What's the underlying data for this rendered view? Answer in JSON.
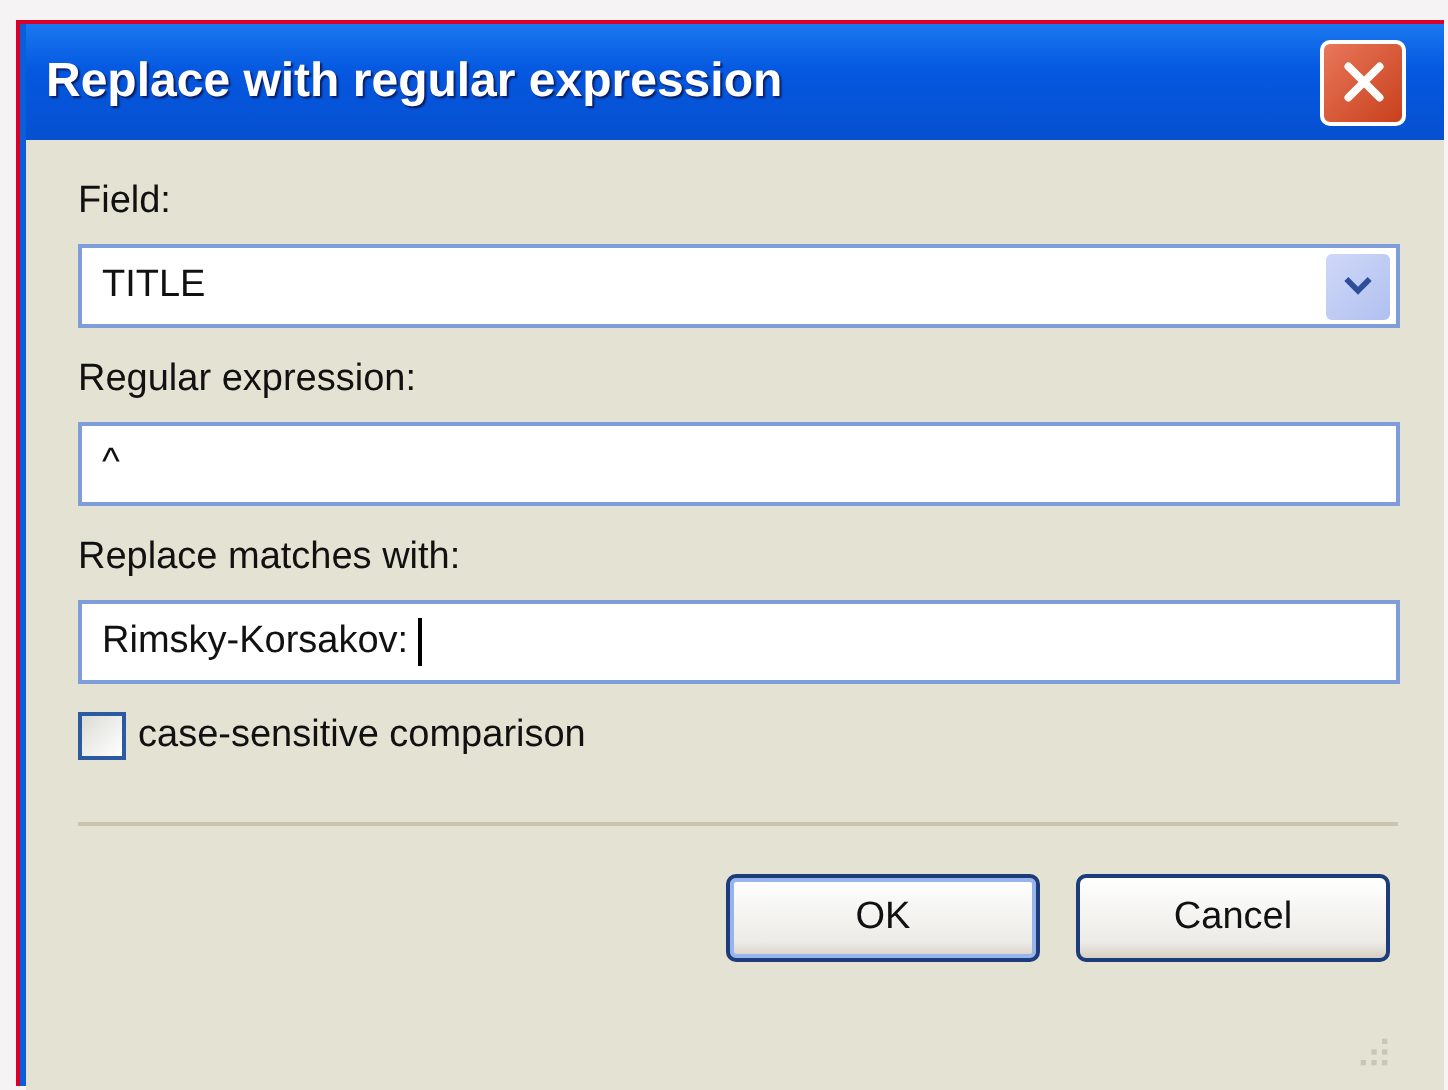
{
  "window": {
    "title": "Replace with regular expression"
  },
  "fields": [
    {
      "kind": "dropdown",
      "label": "Field:",
      "value": "TITLE"
    },
    {
      "kind": "text",
      "label": "Regular expression:",
      "value": "^"
    },
    {
      "kind": "text",
      "label": "Replace matches with:",
      "value": "Rimsky-Korsakov: ",
      "focused": true
    }
  ],
  "checkbox": {
    "label": "case-sensitive comparison",
    "checked": false
  },
  "buttons": [
    {
      "label": "OK",
      "default": true
    },
    {
      "label": "Cancel",
      "default": false
    }
  ]
}
